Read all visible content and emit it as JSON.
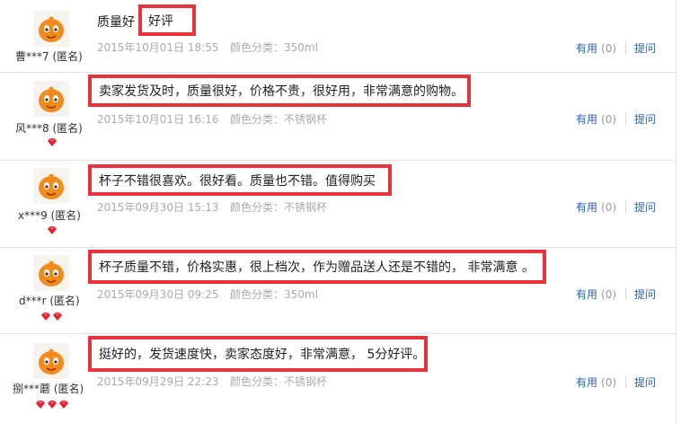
{
  "labels": {
    "useful": "有用",
    "ask": "提问",
    "color_prefix": "颜色分类："
  },
  "colors": {
    "highlight_border": "#e8323c",
    "link": "#2a62b0",
    "meta": "#aaaaaa",
    "avatar": "#f28b1d"
  },
  "reviews": [
    {
      "user": "曹***7 (匿名)",
      "badge_count": 0,
      "content_prefix": "质量好",
      "content": "好评",
      "date": "2015年10月01日 18:55",
      "color": "350ml",
      "useful_count": "(0)"
    },
    {
      "user": "风***8 (匿名)",
      "badge_count": 1,
      "content": "卖家发货及时，质量很好，价格不贵，很好用，非常满意的购物。",
      "date": "2015年10月01日 16:16",
      "color": "不锈钢杯",
      "useful_count": "(0)"
    },
    {
      "user": "x***9 (匿名)",
      "badge_count": 1,
      "content": "杯子不错很喜欢。很好看。质量也不错。值得购买",
      "date": "2015年09月30日 15:13",
      "color": "不锈钢杯",
      "useful_count": "(0)"
    },
    {
      "user": "d***r (匿名)",
      "badge_count": 2,
      "content": "杯子质量不错，价格实惠，很上档次，作为赠品送人还是不错的， 非常满意 。",
      "date": "2015年09月30日 09:25",
      "color": "350ml",
      "useful_count": "(0)"
    },
    {
      "user": "捌***蘑 (匿名)",
      "badge_count": 3,
      "content": "挺好的，发货速度快，卖家态度好，非常满意， 5分好评。",
      "date": "2015年09月29日 22:23",
      "color": "不锈钢杯",
      "useful_count": "(0)"
    }
  ]
}
